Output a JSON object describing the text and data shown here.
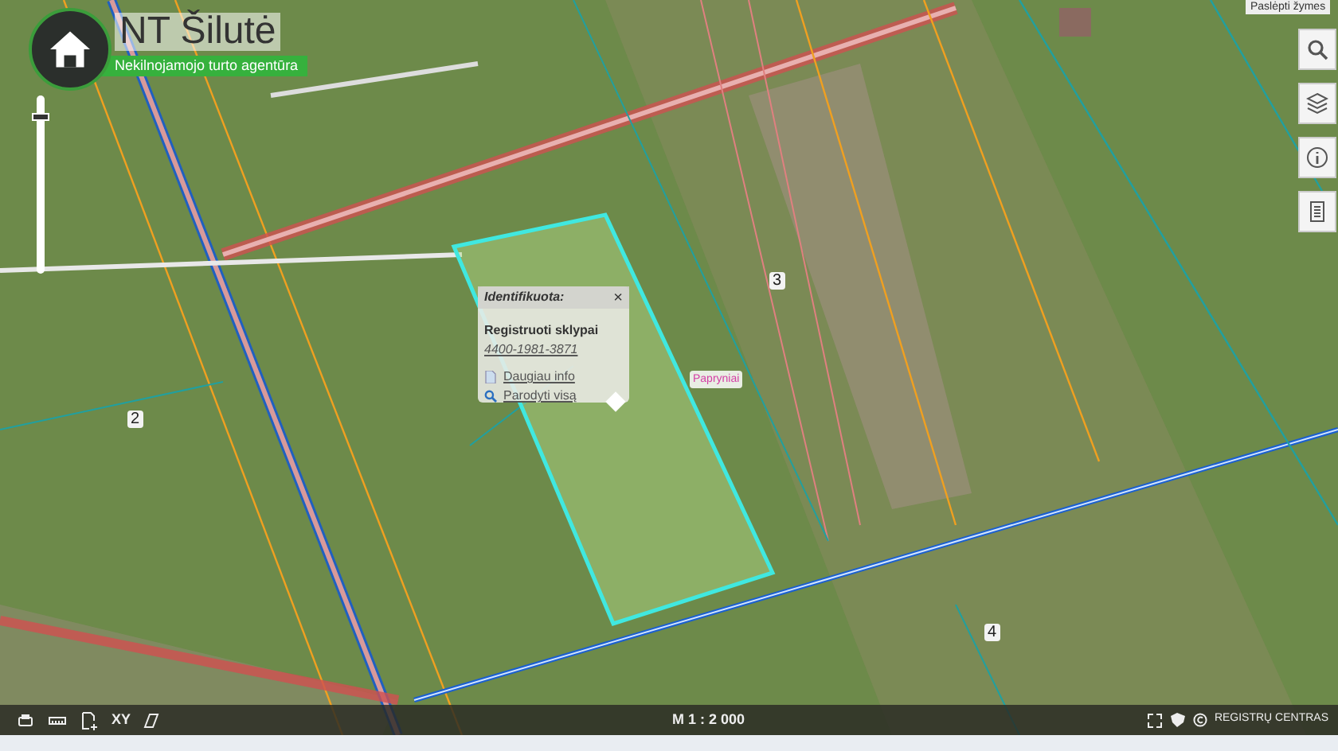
{
  "logo": {
    "title": "NT Šilutė",
    "subtitle": "Nekilnojamojo turto agentūra"
  },
  "tooltip": "Paslėpti žymes",
  "map": {
    "labels": [
      {
        "text": "2"
      },
      {
        "text": "3"
      },
      {
        "text": "4"
      },
      {
        "text": "Papryniai"
      }
    ]
  },
  "zoom_slider": {
    "level": 0.9
  },
  "popup": {
    "title": "Identifikuota:",
    "close": "×",
    "heading": "Registruoti sklypai",
    "parcel_id": "4400-1981-3871",
    "links": [
      "Daugiau info",
      "Parodyti visą"
    ]
  },
  "toolbar": {
    "xy_label": "XY"
  },
  "scale": "M 1 : 2 000",
  "copyright": "REGISTRŲ CENTRAS"
}
